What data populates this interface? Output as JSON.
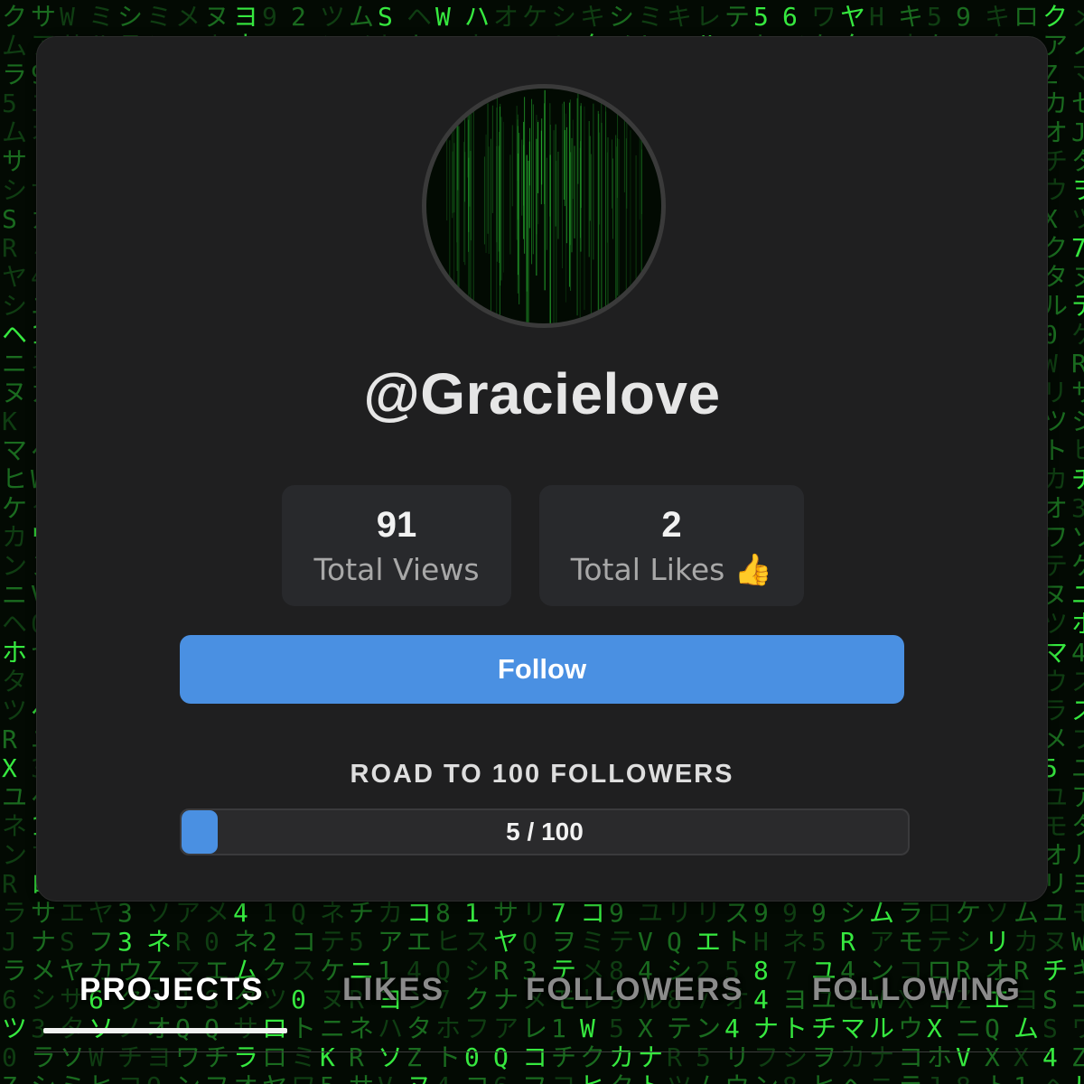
{
  "profile": {
    "username": "@Gracielove",
    "stats": {
      "views": {
        "value": "91",
        "label": "Total Views"
      },
      "likes": {
        "value": "2",
        "label": "Total Likes",
        "emoji": "👍"
      }
    },
    "follow_label": "Follow",
    "road": {
      "title": "ROAD TO 100 FOLLOWERS",
      "current": 5,
      "goal": 100,
      "text": "5 / 100"
    }
  },
  "tabs": [
    {
      "label": "PROJECTS",
      "active": true
    },
    {
      "label": "LIKES",
      "active": false
    },
    {
      "label": "FOLLOWERS",
      "active": false
    },
    {
      "label": "FOLLOWING",
      "active": false
    }
  ],
  "colors": {
    "accent": "#4a90e2",
    "card": "#1f1f20",
    "stat_box": "#28292c",
    "matrix_green": "#2fd63a",
    "background": "#030a03"
  }
}
